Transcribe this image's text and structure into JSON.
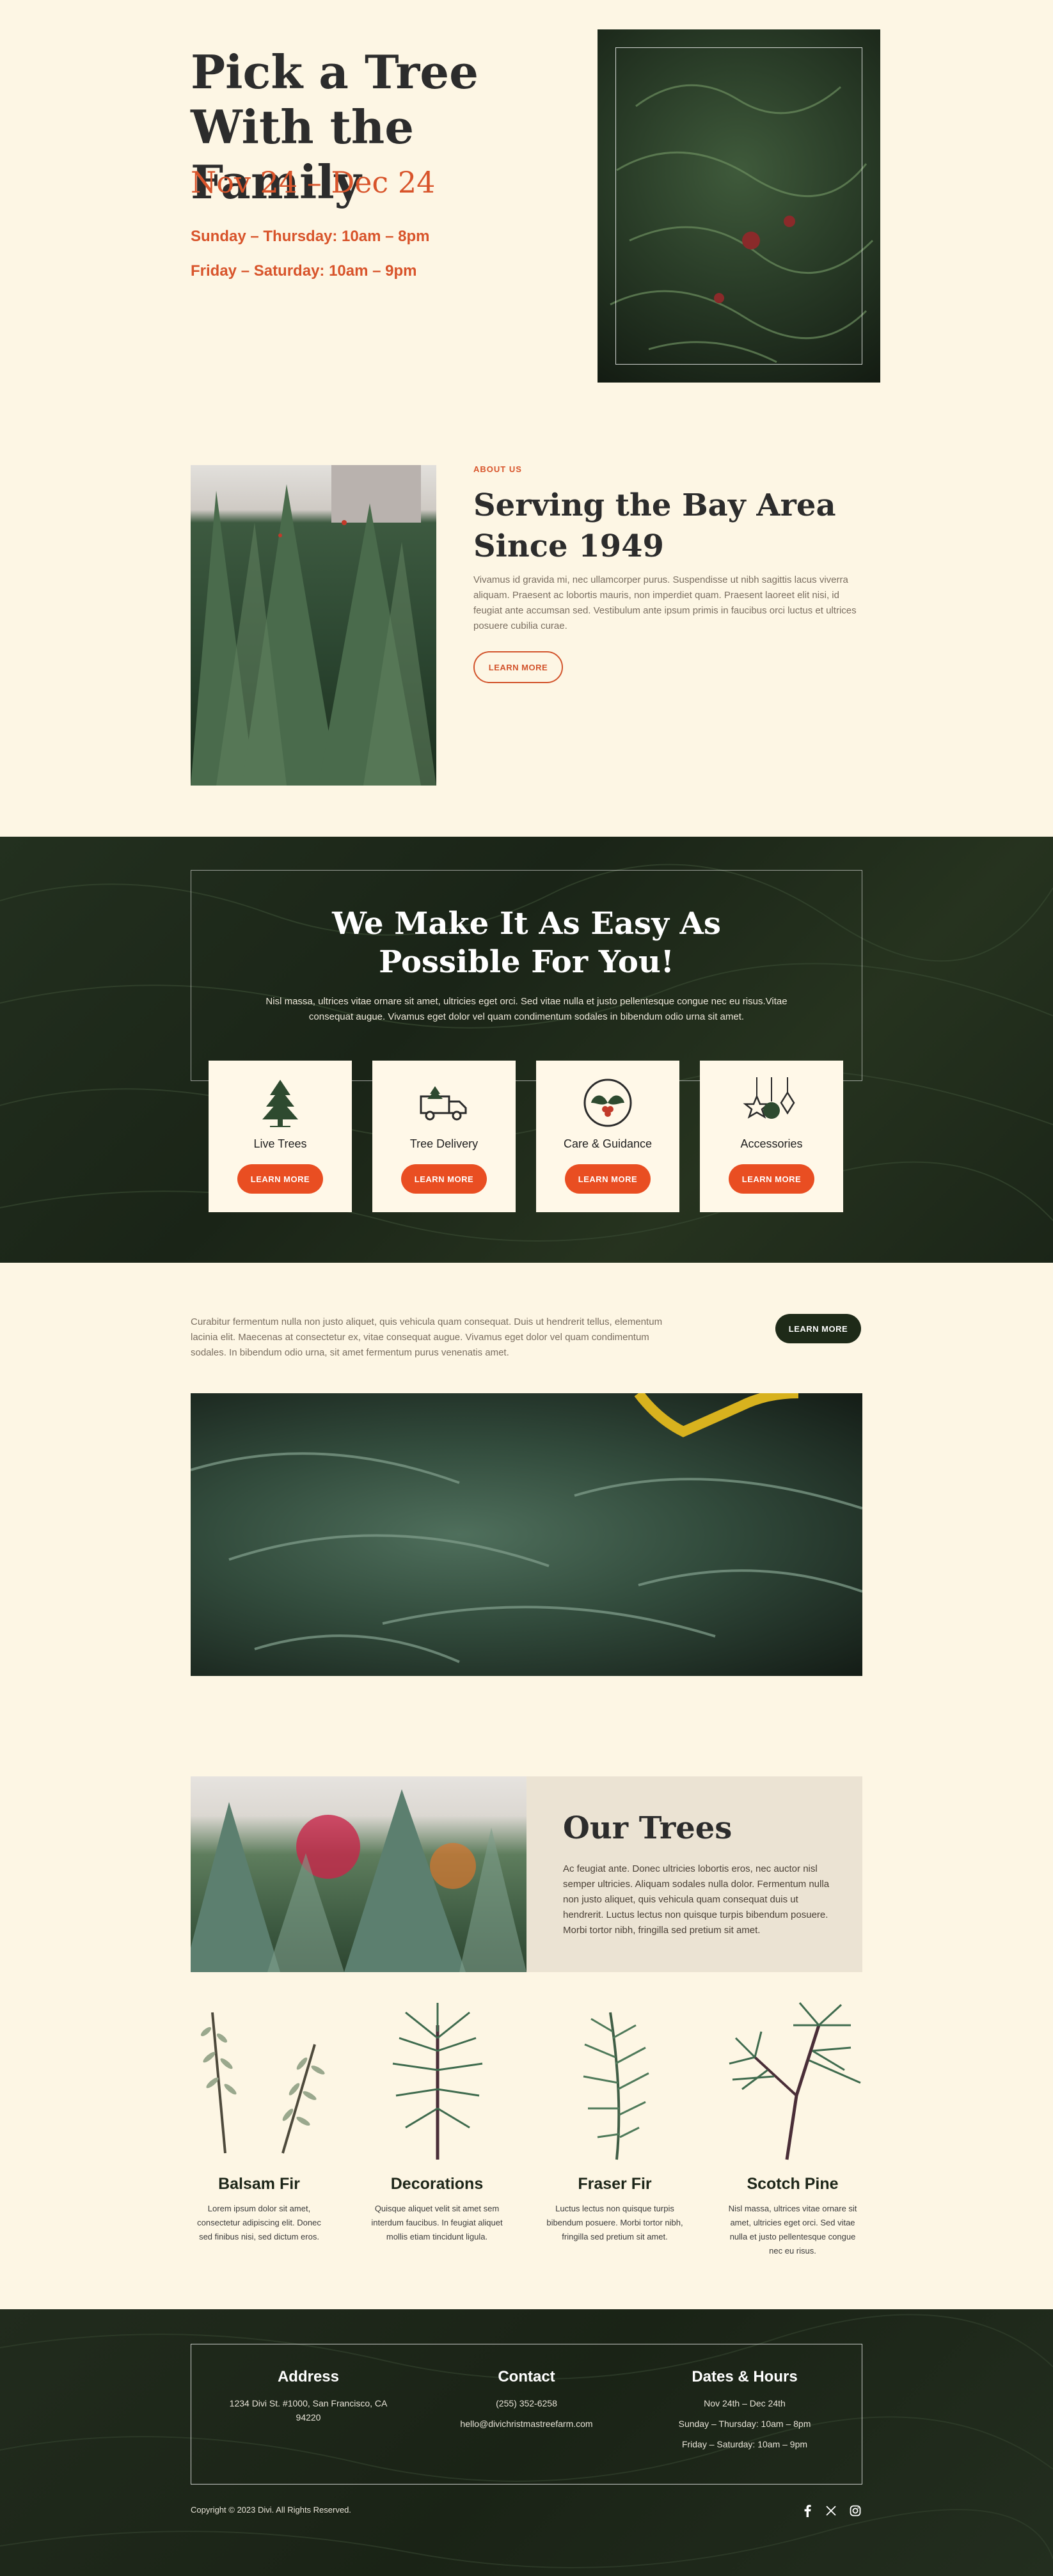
{
  "hero": {
    "title": "Pick a Tree With the Family",
    "dates": "Nov 24 – Dec 24",
    "hours_weekday": "Sunday – Thursday: 10am – 8pm",
    "hours_weekend": "Friday – Saturday: 10am – 9pm"
  },
  "about": {
    "eyebrow": "ABOUT US",
    "title": "Serving the Bay Area Since 1949",
    "body": "Vivamus id gravida mi, nec ullamcorper purus. Suspendisse ut nibh sagittis lacus viverra aliquam. Praesent ac lobortis mauris, non imperdiet quam. Praesent laoreet elit nisi, id feugiat ante accumsan sed. Vestibulum ante ipsum primis in faucibus orci luctus et ultrices posuere cubilia curae.",
    "button": "LEARN MORE"
  },
  "services": {
    "title": "We Make It As Easy As Possible For You!",
    "body": "Nisl massa, ultrices vitae ornare sit amet, ultricies eget orci. Sed vitae nulla et justo pellentesque congue nec eu risus.Vitae consequat augue. Vivamus eget dolor vel quam condimentum sodales in bibendum odio urna sit amet.",
    "cards": [
      {
        "label": "Live Trees",
        "icon": "pine-tree-icon",
        "button": "LEARN MORE"
      },
      {
        "label": "Tree Delivery",
        "icon": "delivery-truck-icon",
        "button": "LEARN MORE"
      },
      {
        "label": "Care & Guidance",
        "icon": "holly-badge-icon",
        "button": "LEARN MORE"
      },
      {
        "label": "Accessories",
        "icon": "ornaments-icon",
        "button": "LEARN MORE"
      }
    ]
  },
  "intro": {
    "body": "Curabitur fermentum nulla non justo aliquet, quis vehicula quam consequat. Duis ut hendrerit tellus, elementum lacinia elit. Maecenas at consectetur ex, vitae consequat augue. Vivamus eget dolor vel quam condimentum sodales. In bibendum odio urna, sit amet fermentum purus venenatis amet.",
    "button": "LEARN MORE"
  },
  "our_trees": {
    "title": "Our Trees",
    "body": "Ac feugiat ante. Donec ultricies lobortis eros, nec auctor nisl semper ultricies. Aliquam sodales nulla dolor. Fermentum nulla non justo aliquet, quis vehicula quam consequat duis ut hendrerit. Luctus lectus non quisque turpis bibendum posuere. Morbi tortor nibh, fringilla sed pretium sit amet.",
    "items": [
      {
        "name": "Balsam Fir",
        "desc": "Lorem ipsum dolor sit amet, consectetur adipiscing elit. Donec sed finibus nisi, sed dictum eros."
      },
      {
        "name": "Decorations",
        "desc": "Quisque aliquet velit sit amet sem interdum faucibus. In feugiat aliquet mollis etiam tincidunt ligula."
      },
      {
        "name": "Fraser Fir",
        "desc": "Luctus lectus non quisque turpis bibendum posuere. Morbi tortor nibh, fringilla sed pretium sit amet."
      },
      {
        "name": "Scotch Pine",
        "desc": "Nisl massa, ultrices vitae ornare sit amet, ultricies eget orci. Sed vitae nulla et justo pellentesque congue nec eu risus."
      }
    ]
  },
  "footer": {
    "address_title": "Address",
    "address": "1234 Divi St. #1000, San Francisco, CA 94220",
    "contact_title": "Contact",
    "phone": "(255) 352-6258",
    "email": "hello@divichristmastreefarm.com",
    "hours_title": "Dates & Hours",
    "dates": "Nov 24th – Dec 24th",
    "hours_weekday": "Sunday – Thursday: 10am – 8pm",
    "hours_weekend": "Friday – Saturday: 10am – 9pm",
    "copyright": "Copyright © 2023 Divi. All Rights Reserved.",
    "social": [
      "facebook-icon",
      "x-icon",
      "instagram-icon"
    ]
  },
  "colors": {
    "cream": "#fdf6e4",
    "accent": "#e94e22",
    "dark_green": "#1f2a1c",
    "beige_panel": "#ebe3d3"
  }
}
